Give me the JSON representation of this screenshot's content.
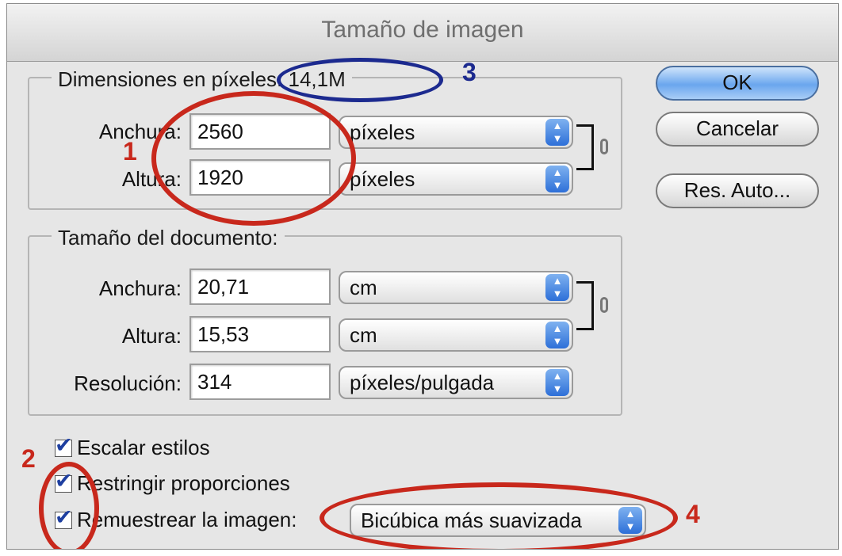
{
  "window": {
    "title": "Tamaño de imagen"
  },
  "pixel_dims": {
    "legend": "Dimensiones en píxeles: 14,1M",
    "width_label": "Anchura:",
    "width_value": "2560",
    "width_unit": "píxeles",
    "height_label": "Altura:",
    "height_value": "1920",
    "height_unit": "píxeles"
  },
  "doc_size": {
    "legend": "Tamaño del documento:",
    "width_label": "Anchura:",
    "width_value": "20,71",
    "width_unit": "cm",
    "height_label": "Altura:",
    "height_value": "15,53",
    "height_unit": "cm",
    "resolution_label": "Resolución:",
    "resolution_value": "314",
    "resolution_unit": "píxeles/pulgada"
  },
  "buttons": {
    "ok": "OK",
    "cancel": "Cancelar",
    "auto": "Res. Auto..."
  },
  "options": {
    "scale_styles": {
      "label": "Escalar estilos",
      "checked": true
    },
    "constrain": {
      "label": "Restringir proporciones",
      "checked": true
    },
    "resample": {
      "label": "Remuestrear la imagen:",
      "checked": true,
      "method": "Bicúbica más suavizada"
    }
  },
  "annotations": {
    "n1": "1",
    "n2": "2",
    "n3": "3",
    "n4": "4"
  },
  "colors": {
    "annotation_red": "#c8281c",
    "annotation_blue": "#1c2a8f",
    "default_button": "#6aa6ee"
  }
}
